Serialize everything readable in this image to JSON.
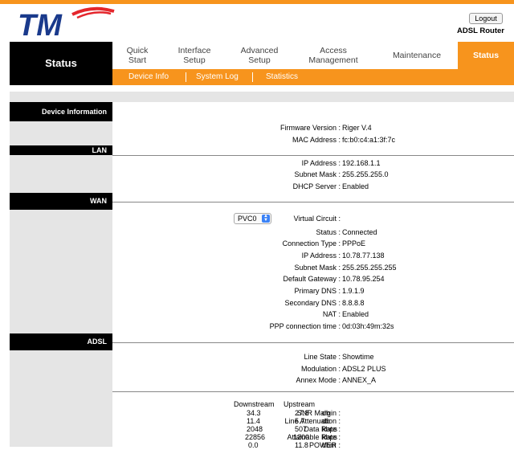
{
  "header": {
    "brand_mark": "TM",
    "logout_label": "Logout",
    "device_name": "ADSL Router",
    "accent": "#f7941d"
  },
  "nav": {
    "title": "Status",
    "tabs": [
      {
        "label": "Quick\nStart"
      },
      {
        "label": "Interface\nSetup"
      },
      {
        "label": "Advanced\nSetup"
      },
      {
        "label": "Access\nManagement"
      },
      {
        "label": "Maintenance"
      },
      {
        "label": "Status"
      }
    ],
    "subtabs": [
      "Device Info",
      "System Log",
      "Statistics"
    ]
  },
  "sections": {
    "device": {
      "title": "Device Information",
      "firmware_label": "Firmware Version :",
      "firmware_value": "Riger V.4",
      "mac_label": "MAC Address :",
      "mac_value": "fc:b0:c4:a1:3f:7c"
    },
    "lan": {
      "title": "LAN",
      "ip_label": "IP Address :",
      "ip_value": "192.168.1.1",
      "mask_label": "Subnet Mask :",
      "mask_value": "255.255.255.0",
      "dhcp_label": "DHCP Server :",
      "dhcp_value": "Enabled"
    },
    "wan": {
      "title": "WAN",
      "vc_label": "Virtual Circuit :",
      "vc_value": "PVC0",
      "status_label": "Status :",
      "status_value": "Connected",
      "conn_label": "Connection Type :",
      "conn_value": "PPPoE",
      "ip_label": "IP Address :",
      "ip_value": "10.78.77.138",
      "mask_label": "Subnet Mask :",
      "mask_value": "255.255.255.255",
      "gw_label": "Default Gateway :",
      "gw_value": "10.78.95.254",
      "pdns_label": "Primary DNS :",
      "pdns_value": "1.9.1.9",
      "sdns_label": "Secondary DNS :",
      "sdns_value": "8.8.8.8",
      "nat_label": "NAT :",
      "nat_value": "Enabled",
      "ppp_label": "PPP connection time :",
      "ppp_value": "0d:03h:49m:32s"
    },
    "adsl": {
      "title": "ADSL",
      "state_label": "Line State :",
      "state_value": "Showtime",
      "mod_label": "Modulation :",
      "mod_value": "ADSL2 PLUS",
      "annex_label": "Annex Mode :",
      "annex_value": "ANNEX_A",
      "stats_headers": [
        "Downstream",
        "Upstream"
      ],
      "stats": [
        {
          "label": "SNR Margin :",
          "down": "34.3",
          "up": "27.8",
          "unit": "db"
        },
        {
          "label": "Line Attenuation :",
          "down": "11.4",
          "up": "5.7",
          "unit": "db"
        },
        {
          "label": "Data Rate :",
          "down": "2048",
          "up": "507",
          "unit": "kbps"
        },
        {
          "label": "Attainable Rate :",
          "down": "22856",
          "up": "1200",
          "unit": "kbps"
        },
        {
          "label": "POWER :",
          "down": "0.0",
          "up": "11.8",
          "unit": "dbm"
        }
      ]
    }
  }
}
